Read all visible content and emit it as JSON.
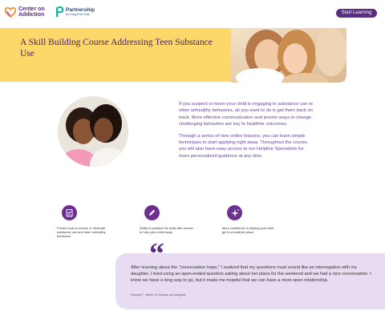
{
  "header": {
    "logo_coa": "Center on Addiction",
    "logo_coa_line1": "Center on",
    "logo_coa_line2": "Addiction",
    "logo_partner_title": "Partnership",
    "logo_partner_sub": "for Drug-Free Kids",
    "start_button": "Start Learning"
  },
  "hero": {
    "title": "A Skill Building Course Addressing Teen Substance Use"
  },
  "intro": {
    "paragraph1": "If you suspect or know your child is engaging in substance use or other unhealthy behaviors, all you want to do is get them back on track. More effective communication and proven ways to change challenging behaviors are key to healthier outcomes.",
    "paragraph2": "Through a series of nine online lessons, you can learn simple techniques to start applying right away. Throughout the course, you will also have easy access to our Helpline Specialists for more personalized guidance at any time."
  },
  "features": [
    {
      "icon": "checklist-icon",
      "text": "Proven tools to reduce or eliminate substance use and other unhealthy behaviors"
    },
    {
      "icon": "pencil-icon",
      "text": "Ability to practice the skills with access to help just a click away"
    },
    {
      "icon": "sparkle-icon",
      "text": "More confidence in helping your child get to a healthier place"
    }
  ],
  "testimonial": {
    "quote": "After learning about the \"conversation traps,\" I realized that my questions must sound like an interrogation with my daughter. I tried using an open-ended question asking about her plans for the weekend and we had a nice conversation. I know we have a long way to go, but it made me hopeful that we can have a more open relationship.",
    "author": "George T., father of 15-year-old daughter"
  },
  "colors": {
    "brand_purple": "#5a2d82",
    "hero_yellow": "#fcd86a",
    "testimonial_bg": "#e8dcf2"
  }
}
